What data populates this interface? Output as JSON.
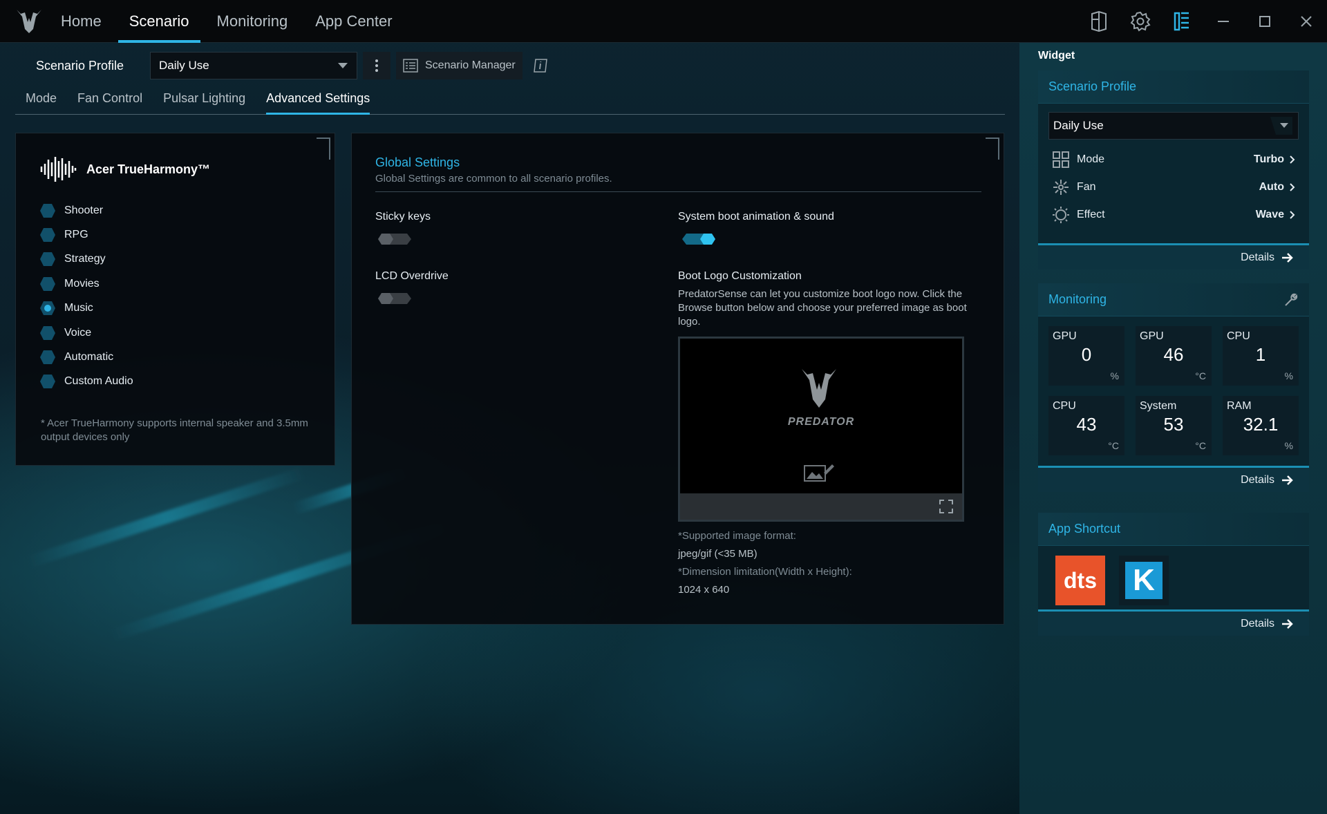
{
  "nav": {
    "tabs": [
      "Home",
      "Scenario",
      "Monitoring",
      "App Center"
    ],
    "active": "Scenario"
  },
  "window_icons": [
    "widget-toggle-icon",
    "settings-gear-icon",
    "sidebar-panel-icon",
    "minimize-icon",
    "maximize-icon",
    "close-icon"
  ],
  "profile": {
    "label": "Scenario Profile",
    "selected": "Daily Use",
    "manager_label": "Scenario Manager"
  },
  "subtabs": {
    "items": [
      "Mode",
      "Fan Control",
      "Pulsar Lighting",
      "Advanced Settings"
    ],
    "active": "Advanced Settings"
  },
  "audio": {
    "title": "Acer TrueHarmony™",
    "options": [
      "Shooter",
      "RPG",
      "Strategy",
      "Movies",
      "Music",
      "Voice",
      "Automatic",
      "Custom Audio"
    ],
    "selected": "Music",
    "note": "* Acer TrueHarmony supports internal speaker and 3.5mm output devices only"
  },
  "global": {
    "title": "Global Settings",
    "subtitle": "Global Settings are common to all scenario profiles.",
    "sticky_keys": {
      "label": "Sticky keys",
      "on": false
    },
    "lcd_overdrive": {
      "label": "LCD Overdrive",
      "on": false
    },
    "boot_anim": {
      "label": "System boot animation & sound",
      "on": true
    },
    "boot_logo": {
      "label": "Boot Logo Customization",
      "description": "PredatorSense can let you customize boot logo now. Click the Browse button below and choose your preferred image as boot logo.",
      "logo_text": "PREDATOR",
      "format_label": "*Supported image format:",
      "format_value": "jpeg/gif (<35 MB)",
      "dimension_label": "*Dimension limitation(Width x Height):",
      "dimension_value": "1024 x 640"
    }
  },
  "widget": {
    "title": "Widget",
    "scenario": {
      "title": "Scenario Profile",
      "selected": "Daily Use",
      "rows": [
        {
          "label": "Mode",
          "value": "Turbo"
        },
        {
          "label": "Fan",
          "value": "Auto"
        },
        {
          "label": "Effect",
          "value": "Wave"
        }
      ],
      "details": "Details"
    },
    "monitoring": {
      "title": "Monitoring",
      "tiles": [
        {
          "label": "GPU",
          "value": "0",
          "unit": "%"
        },
        {
          "label": "GPU",
          "value": "46",
          "unit": "°C"
        },
        {
          "label": "CPU",
          "value": "1",
          "unit": "%"
        },
        {
          "label": "CPU",
          "value": "43",
          "unit": "°C"
        },
        {
          "label": "System",
          "value": "53",
          "unit": "°C"
        },
        {
          "label": "RAM",
          "value": "32.1",
          "unit": "%"
        }
      ],
      "details": "Details"
    },
    "shortcuts": {
      "title": "App Shortcut",
      "apps": [
        {
          "name": "dts",
          "color": "#e8532a"
        },
        {
          "name": "K",
          "color": "#1a9ad6"
        }
      ],
      "details": "Details"
    }
  },
  "colors": {
    "accent": "#2fb5e6",
    "toggle_on": "#1fa6d6",
    "toggle_off": "#3a3f44"
  }
}
